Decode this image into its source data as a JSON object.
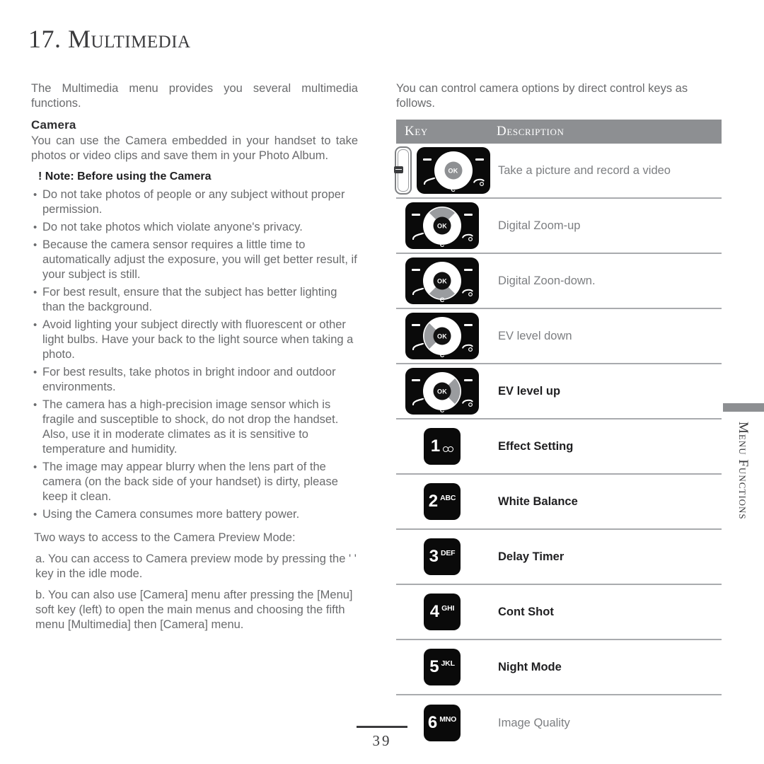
{
  "chapter": {
    "title": "17. Multimedia"
  },
  "left": {
    "intro": "The Multimedia menu provides you several multimedia functions.",
    "camera_heading": "Camera",
    "camera_intro": "You can use the Camera embedded in your handset to take photos or video clips and save them in your Photo Album.",
    "note_heading": "! Note: Before using the Camera",
    "bullets": [
      "Do not take photos of people or any subject without proper permission.",
      "Do not take photos which violate anyone's privacy.",
      "Because the camera sensor requires a little time to automatically adjust the exposure, you will get better result, if your subject is still.",
      "For best result, ensure that the subject has better lighting than the background.",
      "Avoid lighting your subject directly with fluorescent or other light bulbs.  Have your back to the light source when taking a photo.",
      "For best results, take photos in bright indoor and outdoor environments.",
      "The camera has a high-precision image sensor which is fragile and susceptible to shock, do not drop the handset.  Also, use it in moderate climates as it is sensitive to temperature and humidity.",
      "The image may appear blurry when the lens part of the camera (on the back side of your handset) is dirty, please keep it clean.",
      "Using the Camera consumes more battery power."
    ],
    "two_ways_heading": "Two ways to access to the Camera Preview Mode:",
    "way_a": "a. You can access to Camera preview mode by pressing the ' ' key in the idle mode.",
    "way_b": "b. You can also use [Camera] menu after pressing the [Menu] soft key (left) to open the main menus and choosing the fifth menu [Multimedia] then [Camera] menu."
  },
  "right": {
    "intro": "You can control camera options by direct control keys as follows.",
    "table": {
      "header": {
        "key": "Key",
        "description": "Description"
      },
      "rows": [
        {
          "key_type": "sidekey-and-navpad",
          "highlight": "none",
          "ok_style": "grey",
          "ok_label": "OK",
          "c_label": "C",
          "description": "Take a picture and record a video",
          "emphasis": "light"
        },
        {
          "key_type": "navpad",
          "highlight": "up",
          "ok_style": "solid",
          "ok_label": "OK",
          "c_label": "C",
          "description": "Digital Zoom-up",
          "emphasis": "light"
        },
        {
          "key_type": "navpad",
          "highlight": "down",
          "ok_style": "solid",
          "ok_label": "OK",
          "c_label": "C",
          "description": "Digital Zoon-down.",
          "emphasis": "light"
        },
        {
          "key_type": "navpad",
          "highlight": "left",
          "ok_style": "solid",
          "ok_label": "OK",
          "c_label": "C",
          "description": "EV level down",
          "emphasis": "light"
        },
        {
          "key_type": "navpad",
          "highlight": "right",
          "ok_style": "solid",
          "ok_label": "OK",
          "c_label": "C",
          "description": "EV level up",
          "emphasis": "dark"
        },
        {
          "key_type": "numkey",
          "number": "1",
          "letters": "",
          "icon": "voicemail-icon",
          "description": "Effect Setting",
          "emphasis": "dark"
        },
        {
          "key_type": "numkey",
          "number": "2",
          "letters": "ABC",
          "icon": "",
          "description": "White Balance",
          "emphasis": "dark"
        },
        {
          "key_type": "numkey",
          "number": "3",
          "letters": "DEF",
          "icon": "",
          "description": "Delay Timer",
          "emphasis": "dark"
        },
        {
          "key_type": "numkey",
          "number": "4",
          "letters": "GHI",
          "icon": "",
          "description": "Cont Shot",
          "emphasis": "dark"
        },
        {
          "key_type": "numkey",
          "number": "5",
          "letters": "JKL",
          "icon": "",
          "description": "Night Mode",
          "emphasis": "dark"
        },
        {
          "key_type": "numkey",
          "number": "6",
          "letters": "MNO",
          "icon": "",
          "description": "Image Quality",
          "emphasis": "light"
        }
      ]
    }
  },
  "sidetab": {
    "label": "Menu Functions"
  },
  "footer": {
    "page_number": "39"
  },
  "colors": {
    "header_gray": "#8d8f92",
    "key_black": "#0a0a0a",
    "body_gray": "#6a6b6d",
    "rule_gray": "#a9abae"
  }
}
